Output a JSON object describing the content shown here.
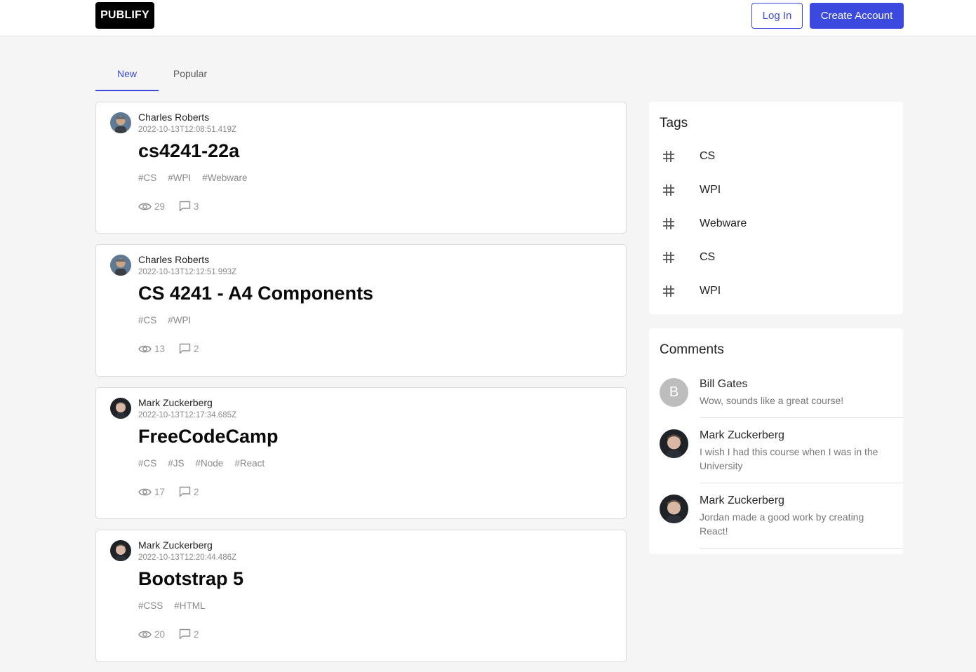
{
  "header": {
    "logo": "PUBLIFY",
    "login_label": "Log In",
    "create_label": "Create Account",
    "accent_color": "#3b49df"
  },
  "tabs": [
    {
      "label": "New",
      "active": true
    },
    {
      "label": "Popular",
      "active": false
    }
  ],
  "posts": [
    {
      "author": "Charles Roberts",
      "date": "2022-10-13T12:08:51.419Z",
      "title": "cs4241-22a",
      "tags": [
        "#CS",
        "#WPI",
        "#Webware"
      ],
      "views": "29",
      "comments": "3"
    },
    {
      "author": "Charles Roberts",
      "date": "2022-10-13T12:12:51.993Z",
      "title": "CS 4241 - A4 Components",
      "tags": [
        "#CS",
        "#WPI"
      ],
      "views": "13",
      "comments": "2"
    },
    {
      "author": "Mark Zuckerberg",
      "date": "2022-10-13T12:17:34.685Z",
      "title": "FreeCodeCamp",
      "tags": [
        "#CS",
        "#JS",
        "#Node",
        "#React"
      ],
      "views": "17",
      "comments": "2"
    },
    {
      "author": "Mark Zuckerberg",
      "date": "2022-10-13T12:20:44.486Z",
      "title": "Bootstrap 5",
      "tags": [
        "#CSS",
        "#HTML"
      ],
      "views": "20",
      "comments": "2"
    }
  ],
  "sidebar": {
    "tags_title": "Tags",
    "tags": [
      "CS",
      "WPI",
      "Webware",
      "CS",
      "WPI"
    ],
    "comments_title": "Comments",
    "comments": [
      {
        "author": "Bill Gates",
        "avatar_letter": "B",
        "text": "Wow, sounds like a great course!"
      },
      {
        "author": "Mark Zuckerberg",
        "avatar_letter": "",
        "text": "I wish I had this course when I was in the University"
      },
      {
        "author": "Mark Zuckerberg",
        "avatar_letter": "",
        "text": "Jordan made a good work by creating React!"
      }
    ]
  }
}
